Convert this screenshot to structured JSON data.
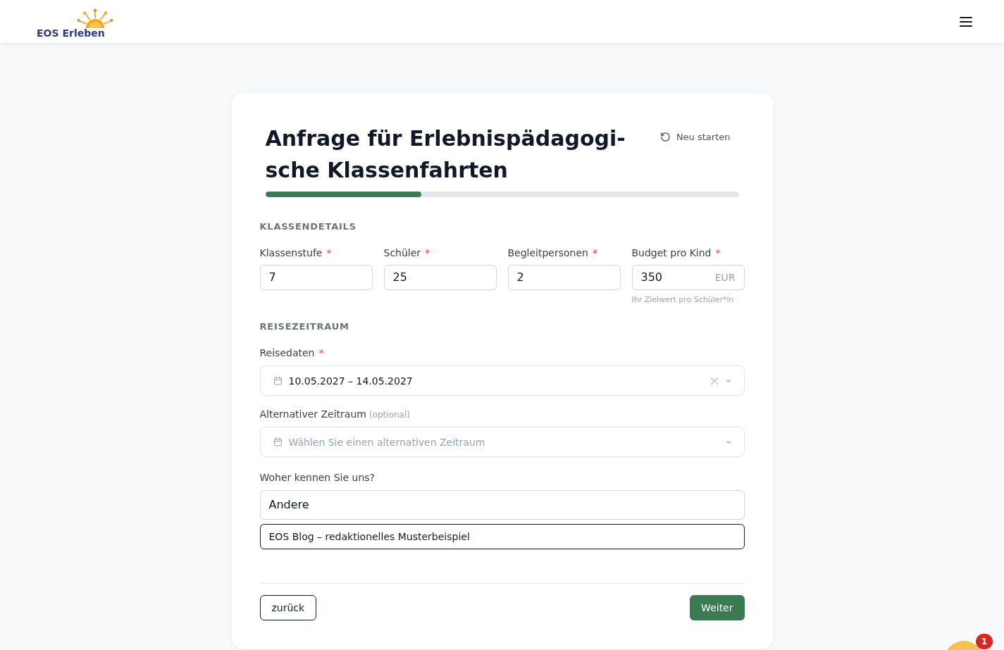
{
  "header": {
    "logo_text": "EOS Erleben"
  },
  "form": {
    "title": "Anfrage für Erlebnispädagogi-sche Klassenfahrten",
    "restart_button": "Neu starten",
    "progress": {
      "level": 0.33
    },
    "sections": [
      {
        "heading": "KLASSENDETAILS",
        "fields": [
          {
            "kind": "text",
            "label": "Klassenstufe",
            "required_mark": "*",
            "value": "7"
          },
          {
            "kind": "text",
            "label": "Schüler",
            "required_mark": "*",
            "value": "25"
          },
          {
            "kind": "text",
            "label": "Begleitpersonen",
            "required_mark": "*",
            "value": "2"
          },
          {
            "kind": "unit",
            "label": "Budget pro Kind",
            "required_mark": "*",
            "value": "350",
            "unit": "EUR",
            "hint": "Ihr Zielwert pro Schüler*in"
          }
        ]
      },
      {
        "heading": "REISEZEITRAUM",
        "fields": [
          {
            "kind": "daterange",
            "label": "Reisedaten",
            "required_mark": "*",
            "value": "10.05.2027 – 14.05.2027"
          },
          {
            "kind": "daterange",
            "label": "Alternativer Zeitraum",
            "note": "(optional)",
            "placeholder": "Wählen Sie einen alternativen Zeitraum"
          }
        ]
      }
    ],
    "source": {
      "label": "Woher kennen Sie uns?",
      "select_value": "Andere",
      "other_input": {
        "value": "EOS Blog – redaktionelles Musterbeispiel",
        "focused": true
      }
    },
    "buttons": {
      "back": "zurück",
      "next": "Weiter"
    }
  },
  "chat_widget": {
    "badge": "1"
  }
}
